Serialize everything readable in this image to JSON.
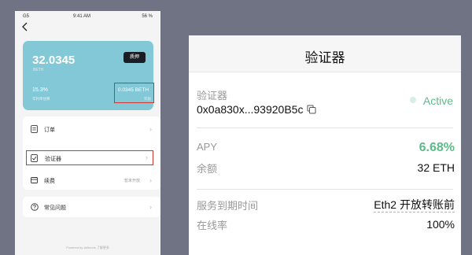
{
  "phone": {
    "status": {
      "carrier": "G5",
      "time": "9:41 AM",
      "battery": "56 %"
    },
    "balance": {
      "amount": "32.0345",
      "unit": "BETH"
    },
    "pledge_button": "质押",
    "apr": {
      "value": "15.3%",
      "label": "年利率估算"
    },
    "reward": {
      "value": "0.0345 BETH",
      "label": "奖励"
    },
    "menu": [
      {
        "label": "订单",
        "value": ""
      },
      {
        "label": "验证器",
        "value": ""
      },
      {
        "label": "续费",
        "value": "暂未开放"
      }
    ],
    "faq": {
      "label": "常见问题"
    },
    "footer": {
      "powered": "Powered by",
      "brand": "ckBonds",
      "link": "了解更多"
    }
  },
  "panel": {
    "title": "验证器",
    "validator_label": "验证器",
    "validator_address": "0x0a830x...93920B5c",
    "status": "Active",
    "apy_label": "APY",
    "apy_value": "6.68%",
    "balance_label": "余额",
    "balance_value": "32 ETH",
    "expiry_label": "服务到期时间",
    "expiry_value": "Eth2 开放转账前",
    "uptime_label": "在线率",
    "uptime_value": "100%"
  },
  "colors": {
    "background": "#707384",
    "card": "#82c8d6",
    "accent_green": "#5dbb8a",
    "highlight_red": "#d0342c"
  },
  "icons": [
    "back-icon",
    "order-icon",
    "validator-check-icon",
    "renew-card-icon",
    "question-icon",
    "chevron-right-icon",
    "copy-icon",
    "status-dot-icon"
  ]
}
